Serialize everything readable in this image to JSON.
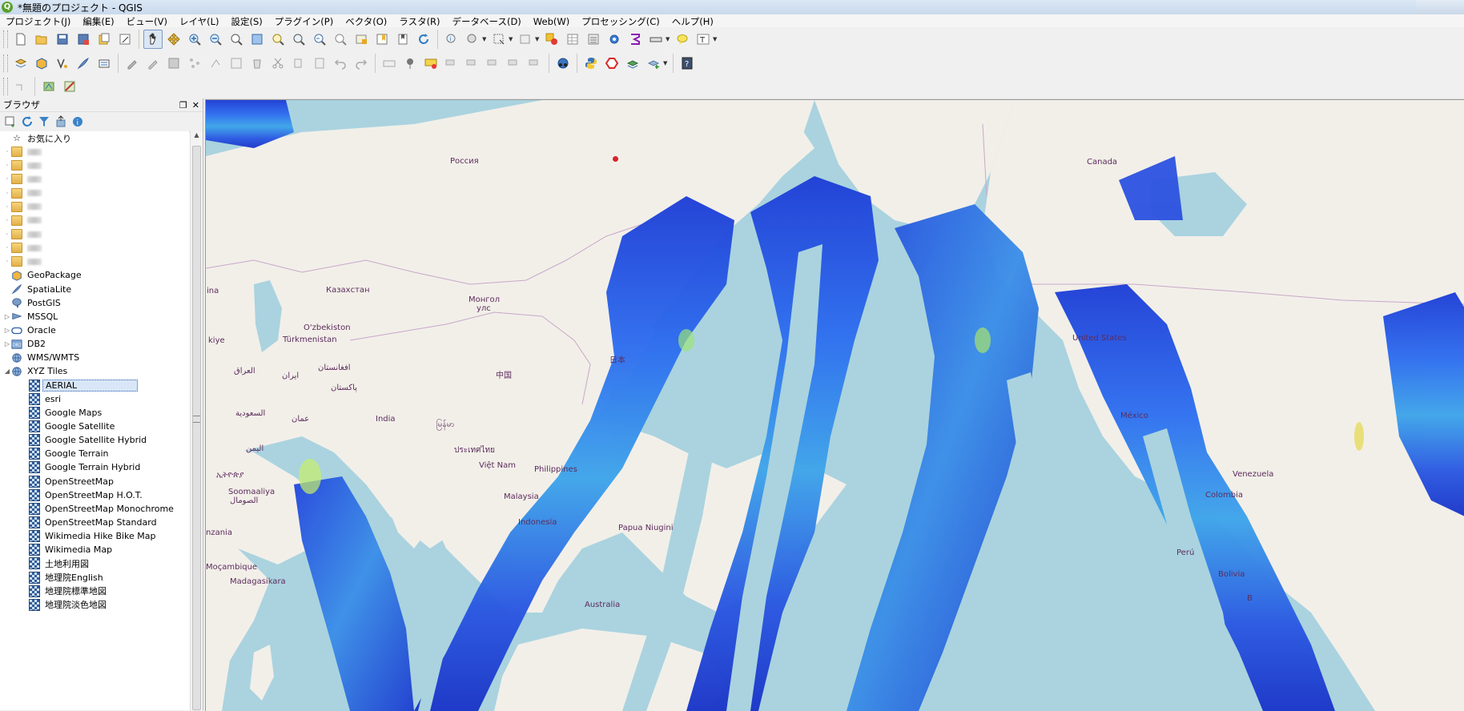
{
  "window": {
    "title": "*無題のプロジェクト - QGIS"
  },
  "menu": [
    "プロジェクト(J)",
    "編集(E)",
    "ビュー(V)",
    "レイヤ(L)",
    "設定(S)",
    "プラグイン(P)",
    "ベクタ(O)",
    "ラスタ(R)",
    "データベース(D)",
    "Web(W)",
    "プロセッシング(C)",
    "ヘルプ(H)"
  ],
  "browser": {
    "title": "ブラウザ",
    "favorites_label": "お気に入り",
    "providers": {
      "geopackage": "GeoPackage",
      "spatialite": "SpatiaLite",
      "postgis": "PostGIS",
      "mssql": "MSSQL",
      "oracle": "Oracle",
      "db2": "DB2",
      "wms": "WMS/WMTS",
      "xyz": "XYZ Tiles"
    },
    "xyz_items": [
      "AERIAL",
      "esri",
      "Google Maps",
      "Google Satellite",
      "Google Satellite Hybrid",
      "Google Terrain",
      "Google Terrain Hybrid",
      "OpenStreetMap",
      "OpenStreetMap H.O.T.",
      "OpenStreetMap Monochrome",
      "OpenStreetMap Standard",
      "Wikimedia Hike Bike Map",
      "Wikimedia Map",
      "土地利用図",
      "地理院English",
      "地理院標準地図",
      "地理院淡色地図"
    ],
    "selected_xyz": "AERIAL"
  },
  "map": {
    "labels": {
      "russia": "Россия",
      "canada": "Canada",
      "kazakhstan": "Казахстан",
      "mongolia_1": "Монгол",
      "mongolia_2": "улс",
      "uzbekistan": "O'zbekiston",
      "turkmenistan": "Türkmenistan",
      "japan": "日本",
      "china": "中国",
      "iraq": "العراق",
      "iran": "ایران",
      "afghanistan": "افغانستان",
      "pakistan": "پاکستان",
      "saudi": "السعودية",
      "oman": "عمان",
      "yemen": "اليمن",
      "india": "India",
      "myanmar": "မြန်မာ",
      "thailand": "ประเทศไทย",
      "vietnam": "Việt Nam",
      "philippines": "Philippines",
      "malaysia": "Malaysia",
      "indonesia": "Indonesia",
      "png": "Papua Niugini",
      "australia": "Australia",
      "usa": "United States",
      "mexico": "México",
      "venezuela": "Venezuela",
      "colombia": "Colombia",
      "peru": "Perú",
      "bolivia": "Bolivia",
      "somalia_1": "Soomaaliya",
      "somalia_2": "الصومال",
      "ethiopia": "ኢትዮጵያ",
      "tanzania": "nzania",
      "mozambique": "Moçambique",
      "madagascar": "Madagasikara",
      "brasil_b": "B",
      "left_ina": "ina",
      "left_kiye": "kiye"
    }
  }
}
